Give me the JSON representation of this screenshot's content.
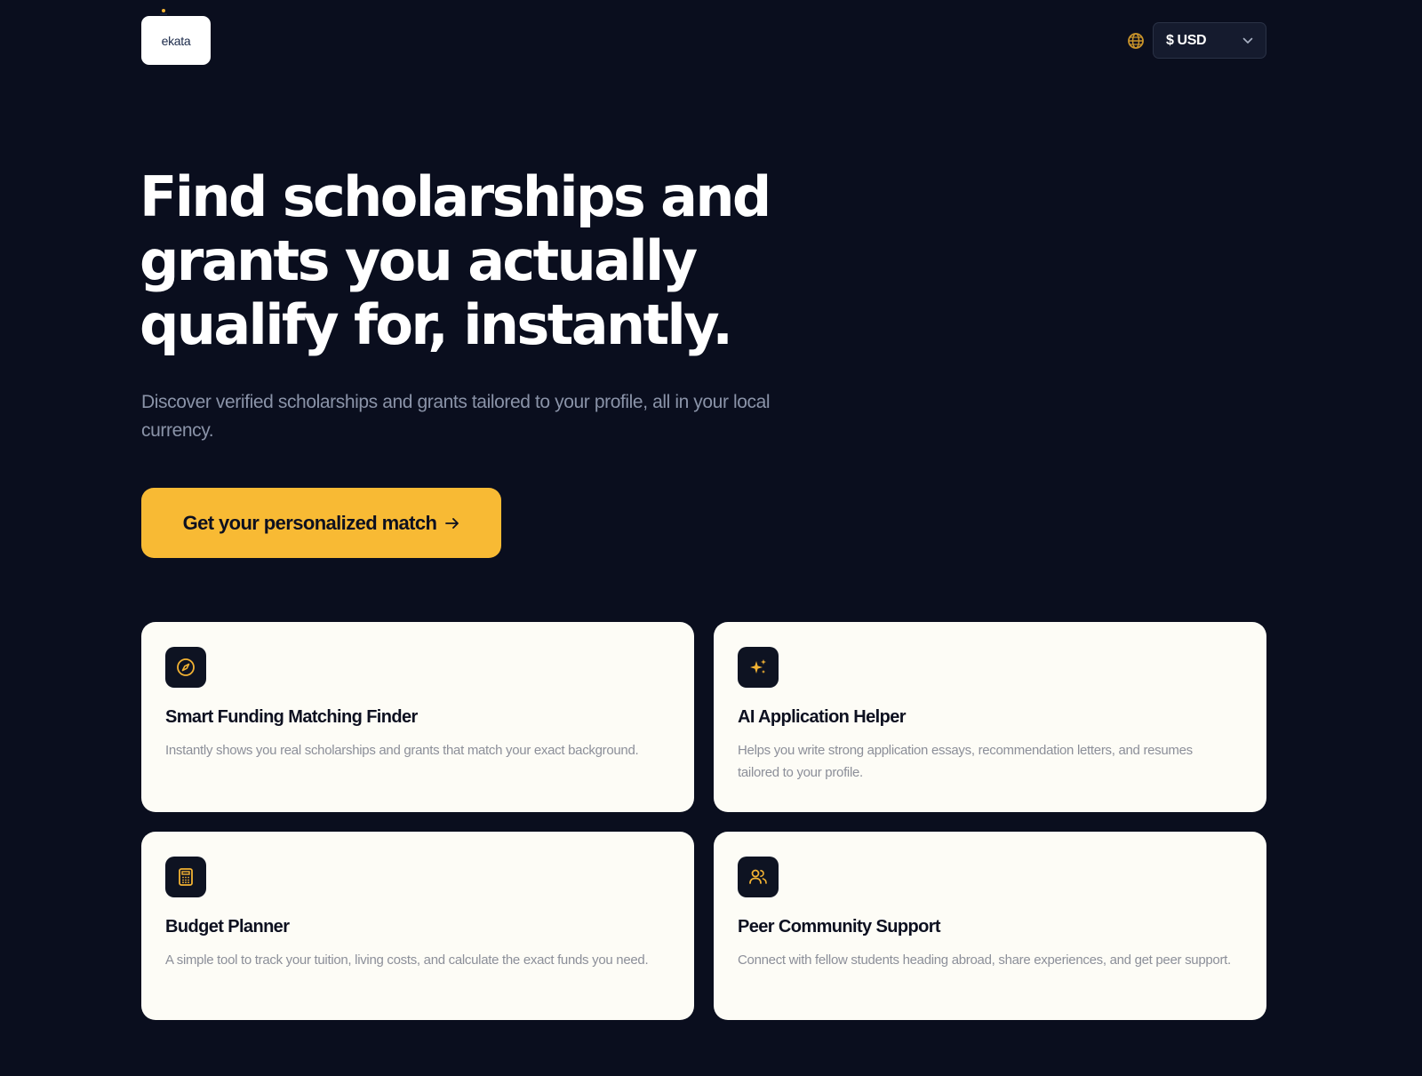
{
  "header": {
    "logo_text": "ekata",
    "currency": {
      "selected": "$ USD"
    }
  },
  "hero": {
    "title": "Find scholarships and grants you actually qualify for, instantly.",
    "subtitle": "Discover verified scholarships and grants tailored to your profile, all in your local currency.",
    "cta_label": "Get your personalized match"
  },
  "features": [
    {
      "icon": "compass-icon",
      "title": "Smart Funding Matching Finder",
      "description": "Instantly shows you real scholarships and grants that match your exact background."
    },
    {
      "icon": "sparkles-icon",
      "title": "AI Application Helper",
      "description": "Helps you write strong application essays, recommendation letters, and resumes tailored to your profile."
    },
    {
      "icon": "calculator-icon",
      "title": "Budget Planner",
      "description": "A simple tool to track your tuition, living costs, and calculate the exact funds you need."
    },
    {
      "icon": "users-icon",
      "title": "Peer Community Support",
      "description": "Connect with fellow students heading abroad, share experiences, and get peer support."
    }
  ],
  "colors": {
    "background": "#0a0e1e",
    "accent": "#f8ba34",
    "card_background": "#fdfcf6",
    "icon_tile": "#0e1322"
  }
}
